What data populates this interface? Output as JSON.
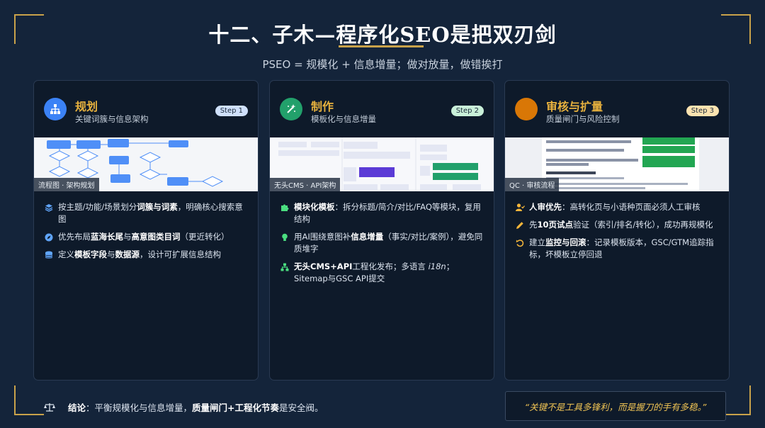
{
  "title": "十二、子木—程序化SEO是把双刃剑",
  "subtitle": "PSEO = 规模化 + 信息增量；做对放量，做错挨打",
  "cards": [
    {
      "title": "规划",
      "subtitle": "关键词簇与信息架构",
      "step": "Step 1",
      "image_tag": "流程图 · 架构规划",
      "icon": "sitemap-icon",
      "accent": "#3b82f6",
      "bullets": [
        {
          "icon": "layers-icon",
          "pre": "按主题/功能/场景划分",
          "b1": "词簇与词素",
          "mid": "，明确核心搜索意图",
          "b2": "",
          "post": ""
        },
        {
          "icon": "compass-icon",
          "pre": "优先布局",
          "b1": "蓝海长尾",
          "mid": "与",
          "b2": "高意图类目词",
          "post": "（更近转化）"
        },
        {
          "icon": "database-icon",
          "pre": "定义",
          "b1": "模板字段",
          "mid": "与",
          "b2": "数据源",
          "post": "，设计可扩展信息结构"
        }
      ]
    },
    {
      "title": "制作",
      "subtitle": "模板化与信息增量",
      "step": "Step 2",
      "image_tag": "无头CMS · API架构",
      "icon": "magic-wand-icon",
      "accent": "#22a06b",
      "bullets": [
        {
          "icon": "puzzle-icon",
          "pre": "",
          "b1": "模块化模板",
          "mid": "：拆分标题/简介/对比/FAQ等模块，复用结构",
          "b2": "",
          "post": ""
        },
        {
          "icon": "lightbulb-icon",
          "pre": "用AI围绕意图补",
          "b1": "信息增量",
          "mid": "（事实/对比/案例），避免同质堆字",
          "b2": "",
          "post": ""
        },
        {
          "icon": "network-icon",
          "pre": "",
          "b1": "无头CMS+API",
          "mid": "工程化发布；多语言 ",
          "b2": "i18n",
          "post": "；Sitemap与GSC API提交"
        }
      ]
    },
    {
      "title": "审核与扩量",
      "subtitle": "质量闸门与风险控制",
      "step": "Step 3",
      "image_tag": "QC · 审核流程",
      "icon": "shield-check-icon",
      "accent": "#d97706",
      "bullets": [
        {
          "icon": "user-check-icon",
          "pre": "",
          "b1": "人审优先",
          "mid": "：高转化页与小语种页面必须人工审核",
          "b2": "",
          "post": ""
        },
        {
          "icon": "pencil-icon",
          "pre": "先",
          "b1": "10页试点",
          "mid": "验证（索引/排名/转化），成功再规模化",
          "b2": "",
          "post": ""
        },
        {
          "icon": "rollback-icon",
          "pre": "建立",
          "b1": "监控与回滚",
          "mid": "：记录模板版本，GSC/GTM追踪指标，坏模板立停回退",
          "b2": "",
          "post": ""
        }
      ]
    }
  ],
  "footer": {
    "label": "结论",
    "text_pre": "：平衡规模化与信息增量，",
    "text_bold": "质量闸门+工程化节奏",
    "text_post": "是安全阀。",
    "icon": "balance-scale-icon"
  },
  "quote": "“关键不是工具多锋利，而是握刀的手有多稳。”",
  "colors": {
    "background": "#14243a",
    "gold": "#c9a24a",
    "title_accent": "#e8b23e"
  }
}
